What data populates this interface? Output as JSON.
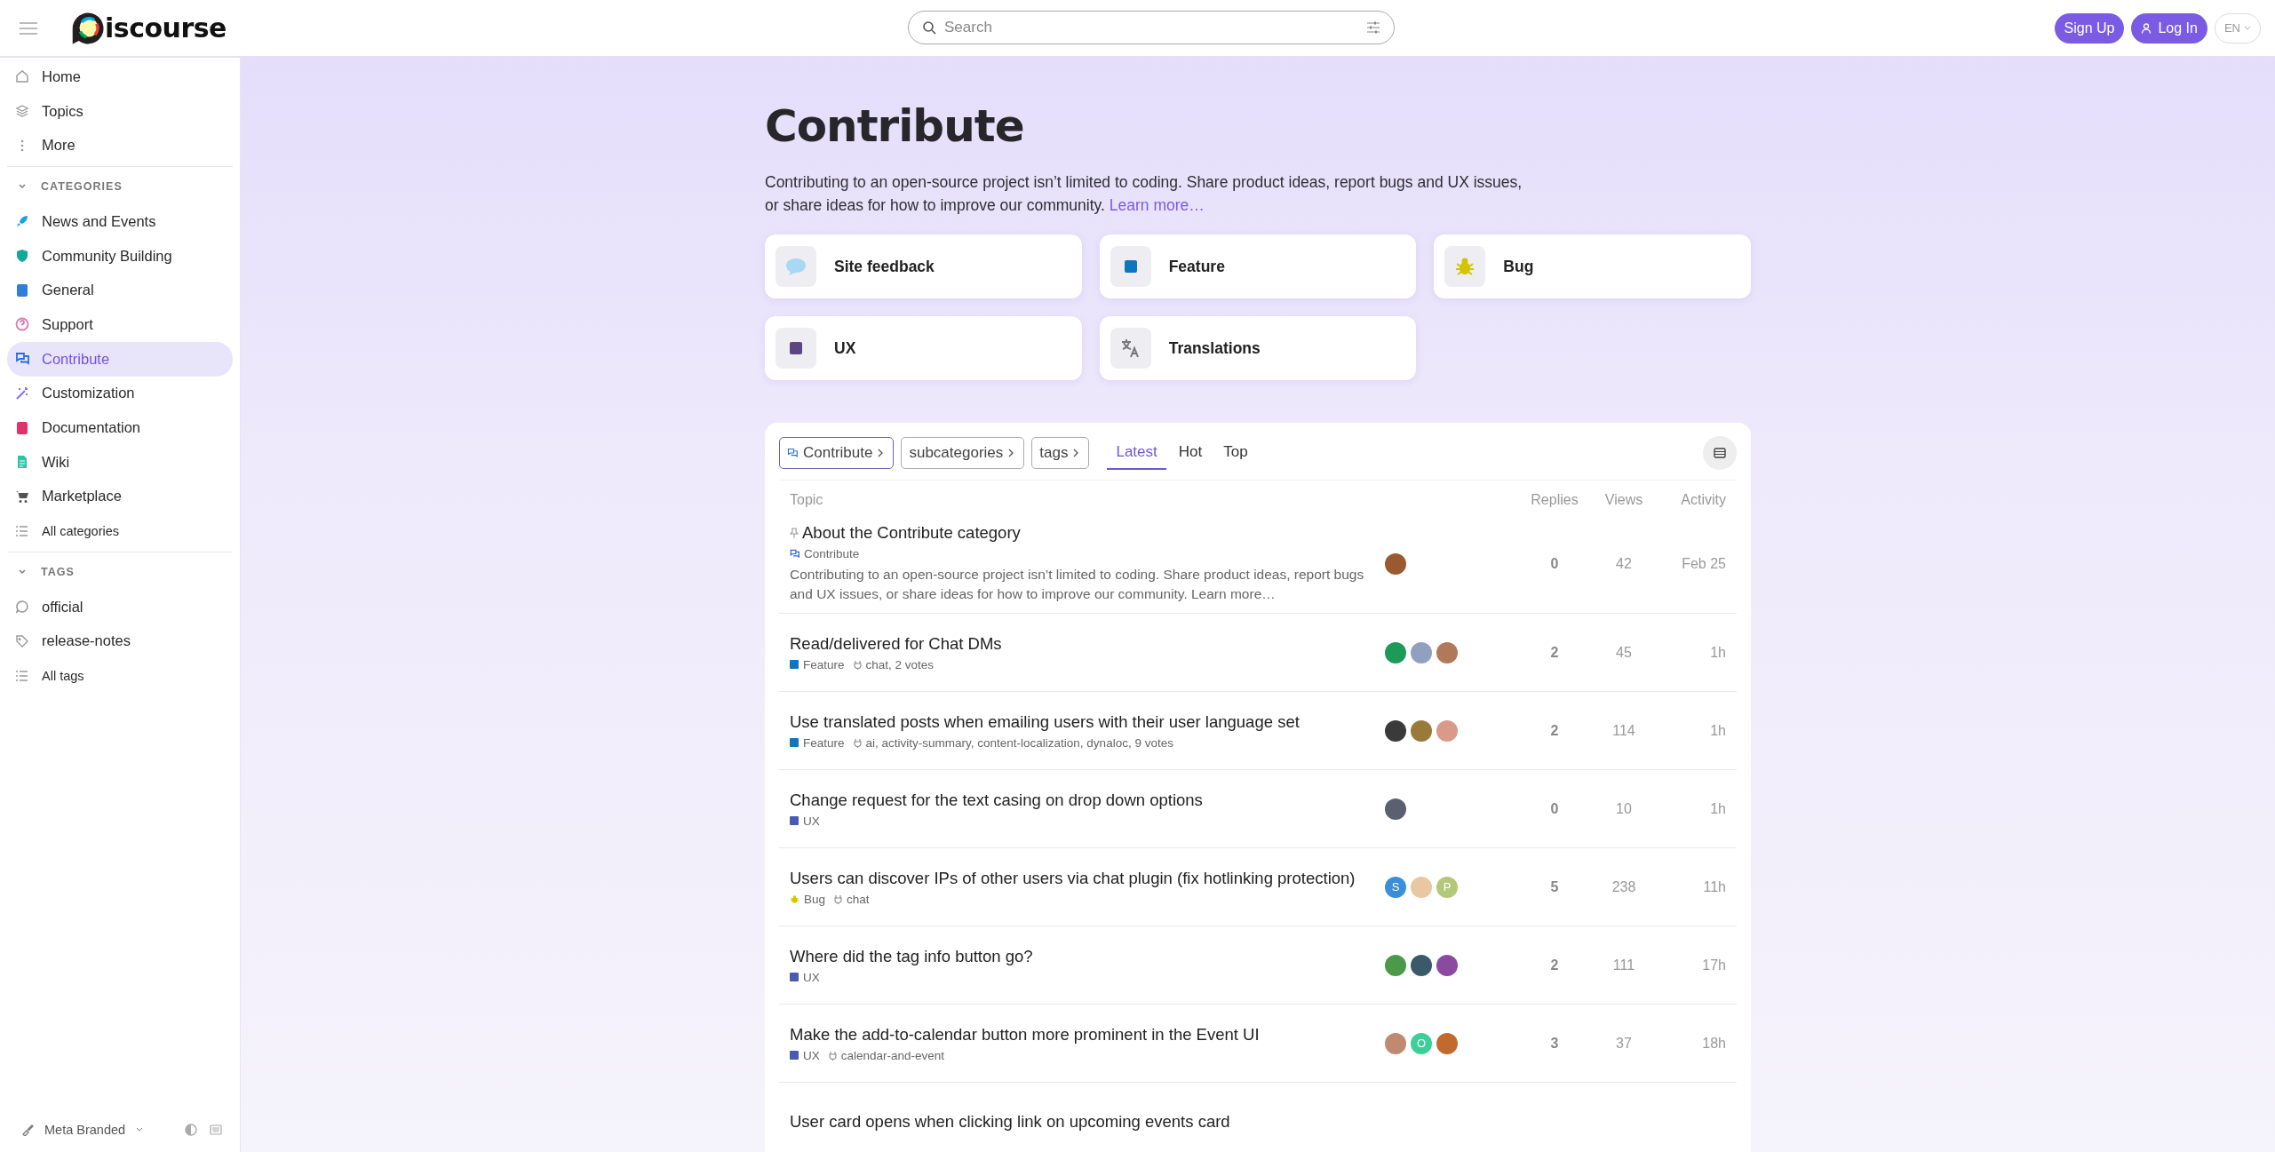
{
  "header": {
    "logo_text": "iscourse",
    "search_placeholder": "Search",
    "signup": "Sign Up",
    "login": "Log In",
    "language": "EN"
  },
  "sidebar": {
    "nav": [
      {
        "label": "Home",
        "selected": false
      },
      {
        "label": "Topics",
        "selected": false
      },
      {
        "label": "More",
        "selected": false
      }
    ],
    "categories_heading": "CATEGORIES",
    "categories": [
      {
        "label": "News and Events",
        "color": "#1ba3e0",
        "selected": false
      },
      {
        "label": "Community Building",
        "color": "#12a89d",
        "selected": false
      },
      {
        "label": "General",
        "color": "#2f7fd6",
        "selected": false
      },
      {
        "label": "Support",
        "color": "#d97ab8",
        "selected": false
      },
      {
        "label": "Contribute",
        "color": "#2b6fd6",
        "selected": true
      },
      {
        "label": "Customization",
        "color": "#8b6cf0",
        "selected": false
      },
      {
        "label": "Documentation",
        "color": "#e0336e",
        "selected": false
      },
      {
        "label": "Wiki",
        "color": "#2ec4a4",
        "selected": false
      },
      {
        "label": "Marketplace",
        "color": "#555555",
        "selected": false
      }
    ],
    "all_categories": "All categories",
    "tags_heading": "TAGS",
    "tags": [
      {
        "label": "official"
      },
      {
        "label": "release-notes"
      }
    ],
    "all_tags": "All tags",
    "theme": "Meta Branded"
  },
  "category": {
    "title": "Contribute",
    "description": "Contributing to an open-source project isn’t limited to coding. Share product ideas, report bugs and UX issues, or share ideas for how to improve our community.",
    "learn_more": "Learn more…",
    "subcategories": [
      {
        "name": "Site feedback",
        "kind": "bubble",
        "color": "#a9d8f5"
      },
      {
        "name": "Feature",
        "kind": "square",
        "color": "#0e76bd"
      },
      {
        "name": "Bug",
        "kind": "bug",
        "color": "#d4c400"
      },
      {
        "name": "UX",
        "kind": "square",
        "color": "#5c4580"
      },
      {
        "name": "Translations",
        "kind": "translate",
        "color": "#777777"
      }
    ]
  },
  "topic_list": {
    "filters": [
      {
        "label": "Contribute",
        "kind": "category"
      },
      {
        "label": "subcategories",
        "kind": "plain"
      },
      {
        "label": "tags",
        "kind": "plain"
      }
    ],
    "tabs": [
      {
        "label": "Latest",
        "selected": true
      },
      {
        "label": "Hot",
        "selected": false
      },
      {
        "label": "Top",
        "selected": false
      }
    ],
    "columns": [
      "Topic",
      "Replies",
      "Views",
      "Activity"
    ],
    "topics": [
      {
        "title": "About the Contribute category",
        "pinned": true,
        "category": {
          "name": "Contribute",
          "kind": "chat",
          "color": "#2b6fd6"
        },
        "excerpt": "Contributing to an open-source project isn’t limited to coding. Share product ideas, report bugs and UX issues, or share ideas for how to improve our community. Learn more…",
        "avatars": [
          {
            "color": "#9a5a30"
          }
        ],
        "replies": "0",
        "views": "42",
        "activity": "Feb 25"
      },
      {
        "title": "Read/delivered for Chat DMs",
        "pinned": false,
        "category": {
          "name": "Feature",
          "kind": "swatch",
          "color": "#0e76bd"
        },
        "tags": "chat, 2 votes",
        "avatars": [
          {
            "color": "#1d9a5a"
          },
          {
            "color": "#8fa0c0"
          },
          {
            "color": "#b07a5a"
          }
        ],
        "replies": "2",
        "views": "45",
        "activity": "1h"
      },
      {
        "title": "Use translated posts when emailing users with their user language set",
        "pinned": false,
        "category": {
          "name": "Feature",
          "kind": "swatch",
          "color": "#0e76bd"
        },
        "tags": "ai, activity-summary, content-localization, dynaloc, 9 votes",
        "avatars": [
          {
            "color": "#3a3a3a"
          },
          {
            "color": "#9a7a3a"
          },
          {
            "color": "#d99a8a"
          }
        ],
        "replies": "2",
        "views": "114",
        "activity": "1h"
      },
      {
        "title": "Change request for the text casing on drop down options",
        "pinned": false,
        "category": {
          "name": "UX",
          "kind": "swatch",
          "color": "#4a5ab0"
        },
        "avatars": [
          {
            "color": "#5a6070"
          }
        ],
        "replies": "0",
        "views": "10",
        "activity": "1h"
      },
      {
        "title": "Users can discover IPs of other users via chat plugin (fix hotlinking protection)",
        "pinned": false,
        "category": {
          "name": "Bug",
          "kind": "bug",
          "color": "#d4c400"
        },
        "tags": "chat",
        "avatars": [
          {
            "color": "#3b8fd9",
            "letter": "S"
          },
          {
            "color": "#e8c8a0"
          },
          {
            "color": "#b4c87a",
            "letter": "P"
          }
        ],
        "replies": "5",
        "views": "238",
        "activity": "11h"
      },
      {
        "title": "Where did the tag info button go?",
        "pinned": false,
        "category": {
          "name": "UX",
          "kind": "swatch",
          "color": "#4a5ab0"
        },
        "avatars": [
          {
            "color": "#4a9a4a"
          },
          {
            "color": "#3a5a6a"
          },
          {
            "color": "#8a4aa0"
          }
        ],
        "replies": "2",
        "views": "111",
        "activity": "17h"
      },
      {
        "title": "Make the add-to-calendar button more prominent in the Event UI",
        "pinned": false,
        "category": {
          "name": "UX",
          "kind": "swatch",
          "color": "#4a5ab0"
        },
        "tags": "calendar-and-event",
        "avatars": [
          {
            "color": "#c08a70"
          },
          {
            "color": "#3ccf9a",
            "letter": "O"
          },
          {
            "color": "#c06a30"
          }
        ],
        "replies": "3",
        "views": "37",
        "activity": "18h"
      },
      {
        "title": "User card opens when clicking link on upcoming events card",
        "pinned": false
      }
    ]
  }
}
